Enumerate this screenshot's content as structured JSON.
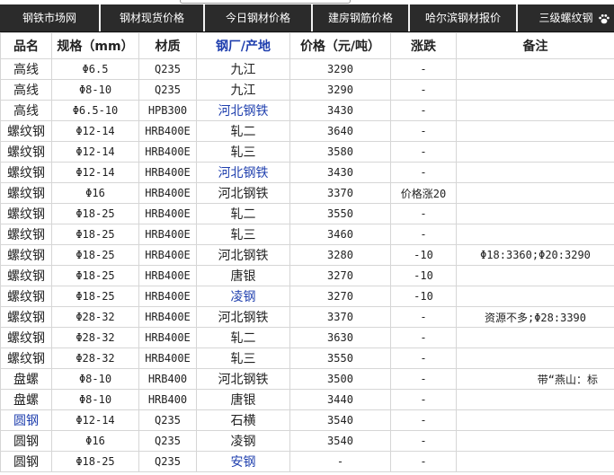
{
  "nav": {
    "items": [
      "钢铁市场网",
      "钢材现货价格",
      "今日钢材价格",
      "建房钢筋价格",
      "哈尔滨钢材报价",
      "三级螺纹钢"
    ],
    "icon": "paw-icon"
  },
  "table": {
    "headers": [
      "品名",
      "规格（mm）",
      "材质",
      "钢厂/产地",
      "价格（元/吨）",
      "涨跌",
      "备注"
    ],
    "rows": [
      {
        "name": "高线",
        "spec": "Φ6.5",
        "material": "Q235",
        "origin": "九江",
        "price": "3290",
        "change": "-",
        "note": ""
      },
      {
        "name": "高线",
        "spec": "Φ8-10",
        "material": "Q235",
        "origin": "九江",
        "price": "3290",
        "change": "-",
        "note": ""
      },
      {
        "name": "高线",
        "spec": "Φ6.5-10",
        "material": "HPB300",
        "origin": "河北钢铁",
        "price": "3430",
        "change": "-",
        "note": ""
      },
      {
        "name": "螺纹钢",
        "spec": "Φ12-14",
        "material": "HRB400E",
        "origin": "轧二",
        "price": "3640",
        "change": "-",
        "note": ""
      },
      {
        "name": "螺纹钢",
        "spec": "Φ12-14",
        "material": "HRB400E",
        "origin": "轧三",
        "price": "3580",
        "change": "-",
        "note": ""
      },
      {
        "name": "螺纹钢",
        "spec": "Φ12-14",
        "material": "HRB400E",
        "origin": "河北钢铁",
        "price": "3430",
        "change": "-",
        "note": ""
      },
      {
        "name": "螺纹钢",
        "spec": "Φ16",
        "material": "HRB400E",
        "origin": "河北钢铁",
        "price": "3370",
        "change": "价格涨20",
        "note": ""
      },
      {
        "name": "螺纹钢",
        "spec": "Φ18-25",
        "material": "HRB400E",
        "origin": "轧二",
        "price": "3550",
        "change": "-",
        "note": ""
      },
      {
        "name": "螺纹钢",
        "spec": "Φ18-25",
        "material": "HRB400E",
        "origin": "轧三",
        "price": "3460",
        "change": "-",
        "note": ""
      },
      {
        "name": "螺纹钢",
        "spec": "Φ18-25",
        "material": "HRB400E",
        "origin": "河北钢铁",
        "price": "3280",
        "change": "-10",
        "note": "Φ18:3360;Φ20:3290"
      },
      {
        "name": "螺纹钢",
        "spec": "Φ18-25",
        "material": "HRB400E",
        "origin": "唐银",
        "price": "3270",
        "change": "-10",
        "note": ""
      },
      {
        "name": "螺纹钢",
        "spec": "Φ18-25",
        "material": "HRB400E",
        "origin": "凌钢",
        "price": "3270",
        "change": "-10",
        "note": ""
      },
      {
        "name": "螺纹钢",
        "spec": "Φ28-32",
        "material": "HRB400E",
        "origin": "河北钢铁",
        "price": "3370",
        "change": "-",
        "note": "资源不多;Φ28:3390"
      },
      {
        "name": "螺纹钢",
        "spec": "Φ28-32",
        "material": "HRB400E",
        "origin": "轧二",
        "price": "3630",
        "change": "-",
        "note": ""
      },
      {
        "name": "螺纹钢",
        "spec": "Φ28-32",
        "material": "HRB400E",
        "origin": "轧三",
        "price": "3550",
        "change": "-",
        "note": ""
      },
      {
        "name": "盘螺",
        "spec": "Φ8-10",
        "material": "HRB400",
        "origin": "河北钢铁",
        "price": "3500",
        "change": "-",
        "note": "带“燕山：标"
      },
      {
        "name": "盘螺",
        "spec": "Φ8-10",
        "material": "HRB400",
        "origin": "唐银",
        "price": "3440",
        "change": "-",
        "note": ""
      },
      {
        "name": "圆钢",
        "spec": "Φ12-14",
        "material": "Q235",
        "origin": "石横",
        "price": "3540",
        "change": "-",
        "note": ""
      },
      {
        "name": "圆钢",
        "spec": "Φ16",
        "material": "Q235",
        "origin": "凌钢",
        "price": "3540",
        "change": "-",
        "note": ""
      },
      {
        "name": "圆钢",
        "spec": "Φ18-25",
        "material": "Q235",
        "origin": "安钢",
        "price": "-",
        "change": "-",
        "note": ""
      }
    ]
  },
  "colors": {
    "nav_bg": "#2b2b2b",
    "link_blue": "#1f3fae",
    "grid_line": "#d6d6d6"
  }
}
